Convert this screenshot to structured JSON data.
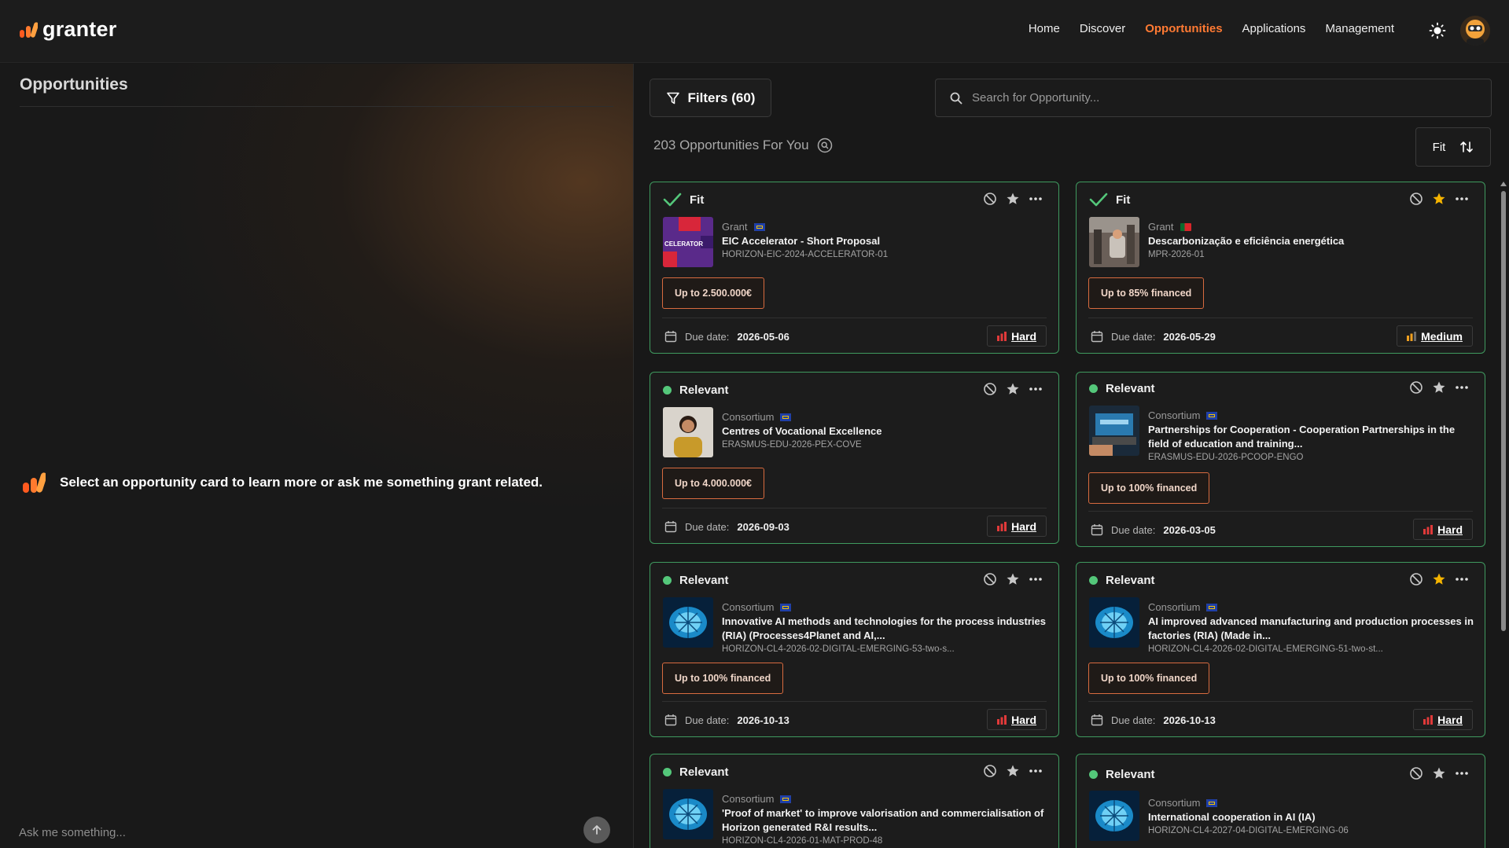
{
  "app": {
    "name": "granter"
  },
  "nav": {
    "items": [
      "Home",
      "Discover",
      "Opportunities",
      "Applications",
      "Management"
    ],
    "active": "Opportunities"
  },
  "left": {
    "title": "Opportunities",
    "prompt": "Select an opportunity card to learn more or ask me something grant related.",
    "ask_placeholder": "Ask me something..."
  },
  "toolbar": {
    "filters_label": "Filters (60)",
    "search_placeholder": "Search for Opportunity...",
    "count_label": "203 Opportunities For You",
    "sort_label": "Fit"
  },
  "colors": {
    "accent": "#ff7a33",
    "fit_border": "#3f9a5f",
    "relevant_dot": "#54c77a",
    "funding_border": "#d86b3f",
    "hard": "#e03a3a",
    "medium": "#f0a020",
    "star_active": "#f5b400"
  },
  "cards": [
    {
      "status": "Fit",
      "status_type": "check",
      "starred": false,
      "type": "Grant",
      "flag": "eu-flag",
      "title": "EIC Accelerator - Short Proposal",
      "code": "HORIZON-EIC-2024-ACCELERATOR-01",
      "thumb": "accelerator-image",
      "thumb_text": "CELERATOR",
      "funding": "Up to 2.500.000€",
      "due_label": "Due date:",
      "due": "2026-05-06",
      "difficulty": "Hard"
    },
    {
      "status": "Fit",
      "status_type": "check",
      "starred": true,
      "type": "Grant",
      "flag": "portugal-flag",
      "title": "Descarbonização e eficiência energética",
      "code": "MPR-2026-01",
      "thumb": "factory-image",
      "funding": "Up to 85% financed",
      "due_label": "Due date:",
      "due": "2026-05-29",
      "difficulty": "Medium"
    },
    {
      "status": "Relevant",
      "status_type": "dot",
      "starred": false,
      "type": "Consortium",
      "flag": "eu-flag",
      "title": "Centres of Vocational Excellence",
      "code": "ERASMUS-EDU-2026-PEX-COVE",
      "thumb": "person-image",
      "funding": "Up to 4.000.000€",
      "due_label": "Due date:",
      "due": "2026-09-03",
      "difficulty": "Hard"
    },
    {
      "status": "Relevant",
      "status_type": "dot",
      "starred": false,
      "type": "Consortium",
      "flag": "eu-flag",
      "title": "Partnerships for Cooperation - Cooperation Partnerships in the field of education and training...",
      "code": "ERASMUS-EDU-2026-PCOOP-ENGO",
      "thumb": "laptop-image",
      "funding": "Up to 100% financed",
      "due_label": "Due date:",
      "due": "2026-03-05",
      "difficulty": "Hard"
    },
    {
      "status": "Relevant",
      "status_type": "dot",
      "starred": false,
      "type": "Consortium",
      "flag": "eu-flag",
      "title": "Innovative AI methods and technologies for the process industries (RIA) (Processes4Planet and AI,...",
      "code": "HORIZON-CL4-2026-02-DIGITAL-EMERGING-53-two-s...",
      "thumb": "brain-image",
      "funding": "Up to 100% financed",
      "due_label": "Due date:",
      "due": "2026-10-13",
      "difficulty": "Hard"
    },
    {
      "status": "Relevant",
      "status_type": "dot",
      "starred": true,
      "type": "Consortium",
      "flag": "eu-flag",
      "title": "AI improved advanced manufacturing and production processes in factories (RIA) (Made in...",
      "code": "HORIZON-CL4-2026-02-DIGITAL-EMERGING-51-two-st...",
      "thumb": "brain-image",
      "funding": "Up to 100% financed",
      "due_label": "Due date:",
      "due": "2026-10-13",
      "difficulty": "Hard"
    },
    {
      "status": "Relevant",
      "status_type": "dot",
      "starred": false,
      "type": "Consortium",
      "flag": "eu-flag",
      "title": "'Proof of market' to improve valorisation and commercialisation of Horizon generated R&I results...",
      "code": "HORIZON-CL4-2026-01-MAT-PROD-48",
      "thumb": "brain-image",
      "funding": "",
      "due_label": "",
      "due": "",
      "difficulty": ""
    },
    {
      "status": "Relevant",
      "status_type": "dot",
      "starred": false,
      "type": "Consortium",
      "flag": "eu-flag",
      "title": "International cooperation in AI (IA)",
      "code": "HORIZON-CL4-2027-04-DIGITAL-EMERGING-06",
      "thumb": "brain-image",
      "funding": "",
      "due_label": "",
      "due": "",
      "difficulty": ""
    }
  ]
}
